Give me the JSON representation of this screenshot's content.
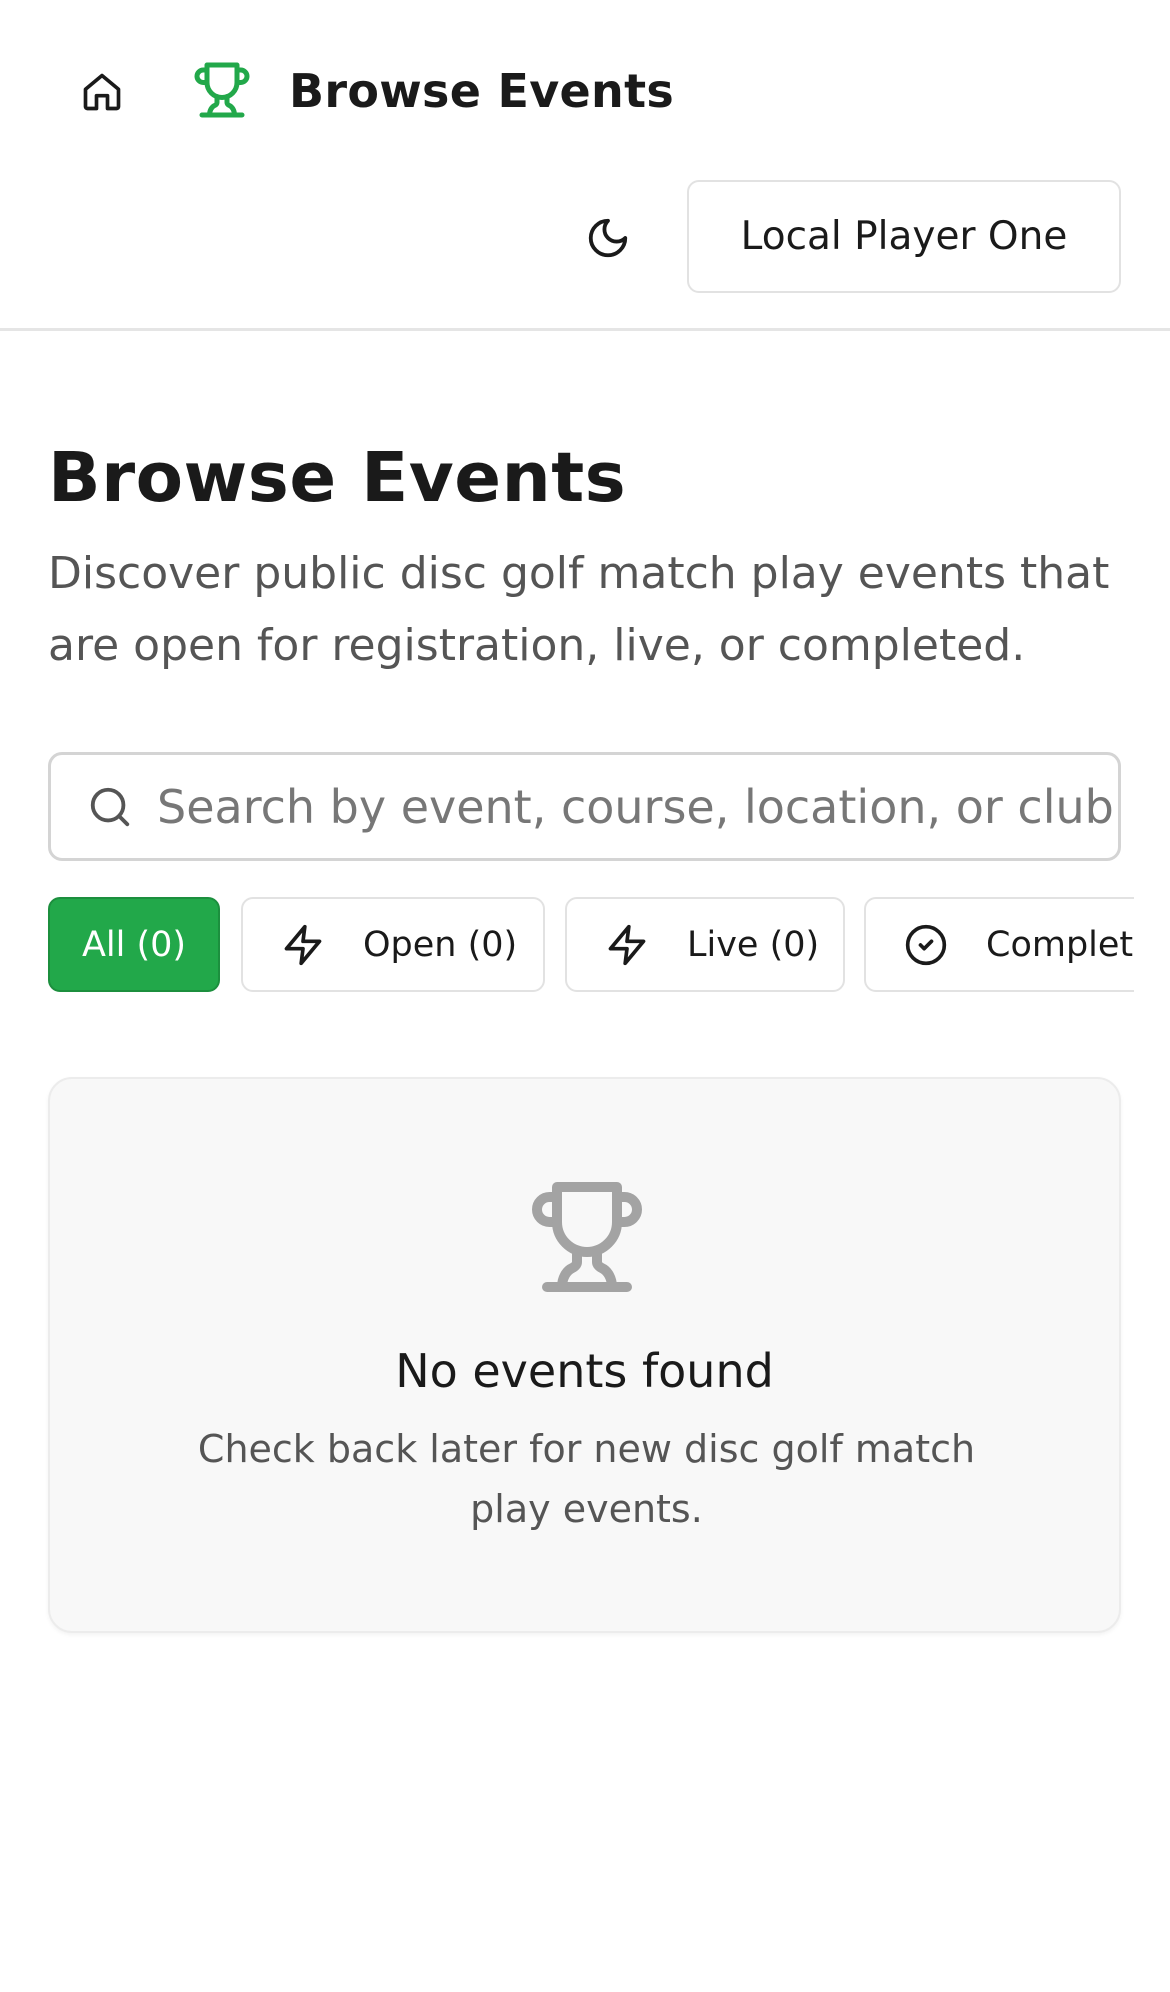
{
  "header": {
    "title": "Browse Events",
    "user_button_label": "Local Player One",
    "icons": {
      "home": "home-icon",
      "logo": "trophy-icon",
      "theme": "moon-icon"
    },
    "brand_color": "#22a84a"
  },
  "main": {
    "title": "Browse Events",
    "description": "Discover public disc golf match play events that are open for registration, live, or completed.",
    "search": {
      "placeholder": "Search by event, course, location, or club...",
      "value": ""
    },
    "filters": [
      {
        "label": "All (0)",
        "active": true,
        "icon": ""
      },
      {
        "label": "Open (0)",
        "active": false,
        "icon": "lightning-icon"
      },
      {
        "label": "Live (0)",
        "active": false,
        "icon": "lightning-icon"
      },
      {
        "label": "Completed",
        "active": false,
        "icon": "check-circle-icon"
      }
    ],
    "empty_state": {
      "title": "No events found",
      "description": "Check back later for new disc golf match play events.",
      "icon": "trophy-icon"
    }
  }
}
